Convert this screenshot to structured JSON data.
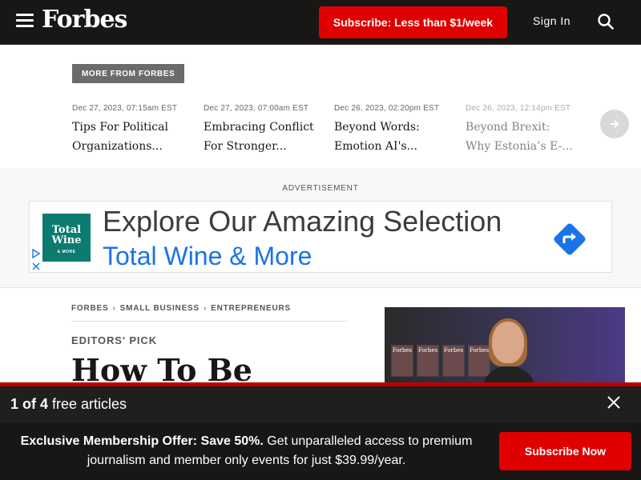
{
  "header": {
    "logo": "Forbes",
    "subscribe_label": "Subscribe: Less than $1/week",
    "signin_label": "Sign In",
    "menu_icon": "hamburger-menu-icon",
    "search_icon": "search-icon"
  },
  "more_from": {
    "label": "MORE FROM FORBES",
    "stories": [
      {
        "date": "Dec 27, 2023, 07:15am EST",
        "headline": "Tips For Political Organizations..."
      },
      {
        "date": "Dec 27, 2023, 07:00am EST",
        "headline": "Embracing Conflict For Stronger..."
      },
      {
        "date": "Dec 26, 2023, 02:20pm EST",
        "headline": "Beyond Words: Emotion AI's..."
      },
      {
        "date": "Dec 26, 2023, 12:14pm EST",
        "headline": "Beyond Brexit: Why Estonia’s E-..."
      }
    ],
    "next_icon": "arrow-right-icon"
  },
  "ad": {
    "label": "ADVERTISEMENT",
    "logo_line1": "Total",
    "logo_line2": "Wine",
    "logo_line3": "& MORE",
    "headline": "Explore Our Amazing Selection",
    "brand": "Total Wine & More"
  },
  "article": {
    "breadcrumb": [
      "FORBES",
      "SMALL BUSINESS",
      "ENTREPRENEURS"
    ],
    "kicker": "EDITORS' PICK",
    "title": "How To Be",
    "video_mag_text": "Forbes"
  },
  "meter": {
    "count": "1 of 4",
    "text": " free articles",
    "close_icon": "close-icon"
  },
  "offer": {
    "bold": "Exclusive Membership Offer: Save 50%.",
    "text": " Get unparalleled access to premium journalism and member only events for just $39.99/year.",
    "button": "Subscribe Now"
  },
  "colors": {
    "brand_red": "#e00000",
    "header_bg": "#181716",
    "ad_blue": "#1a73e8",
    "ad_green": "#0b7c6f"
  }
}
